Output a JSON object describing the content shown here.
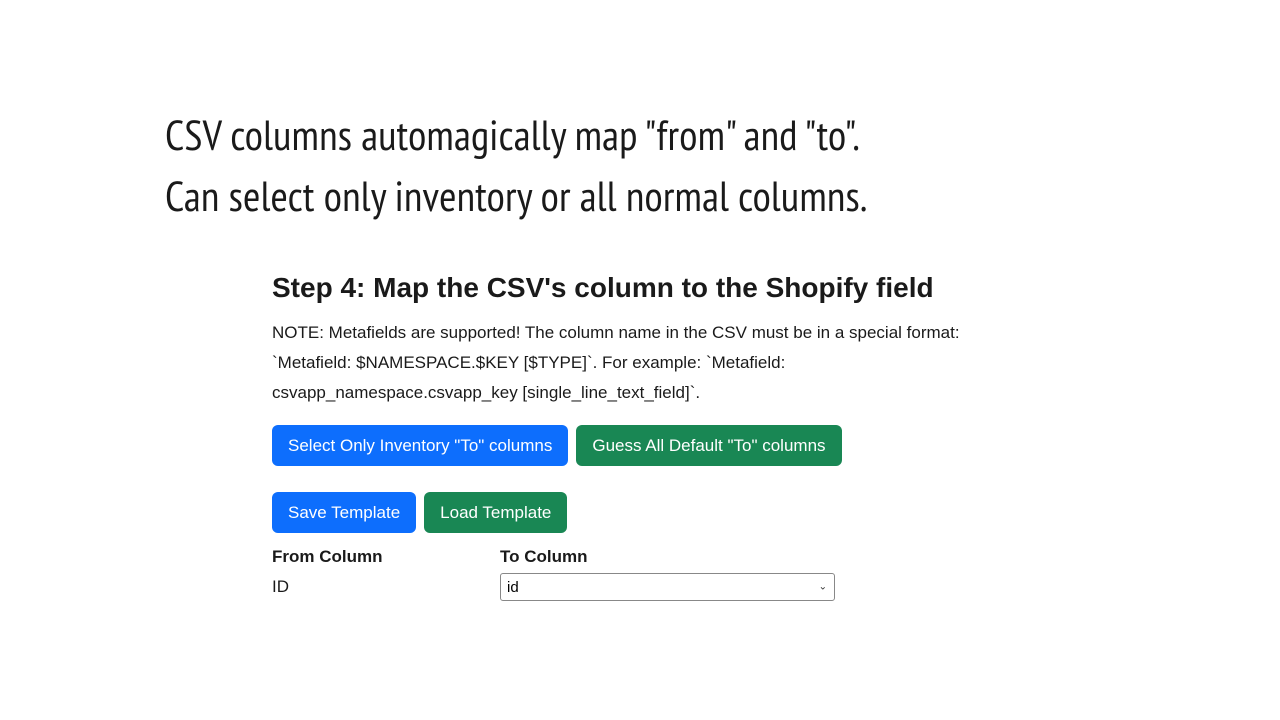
{
  "hero": {
    "line1": "CSV columns automagically map \"from\" and \"to\".",
    "line2": "Can select only inventory or all normal columns."
  },
  "panel": {
    "heading": "Step 4: Map the CSV's column to the Shopify field",
    "note": "NOTE: Metafields are supported! The column name in the CSV must be in a special format: `Metafield: $NAMESPACE.$KEY [$TYPE]`. For example: `Metafield: csvapp_namespace.csvapp_key [single_line_text_field]`.",
    "buttons": {
      "select_inventory": "Select Only Inventory \"To\" columns",
      "guess_default": "Guess All Default \"To\" columns",
      "save_template": "Save Template",
      "load_template": "Load Template"
    },
    "headers": {
      "from": "From Column",
      "to": "To Column"
    },
    "row": {
      "from_value": "ID",
      "to_selected": "id"
    }
  }
}
